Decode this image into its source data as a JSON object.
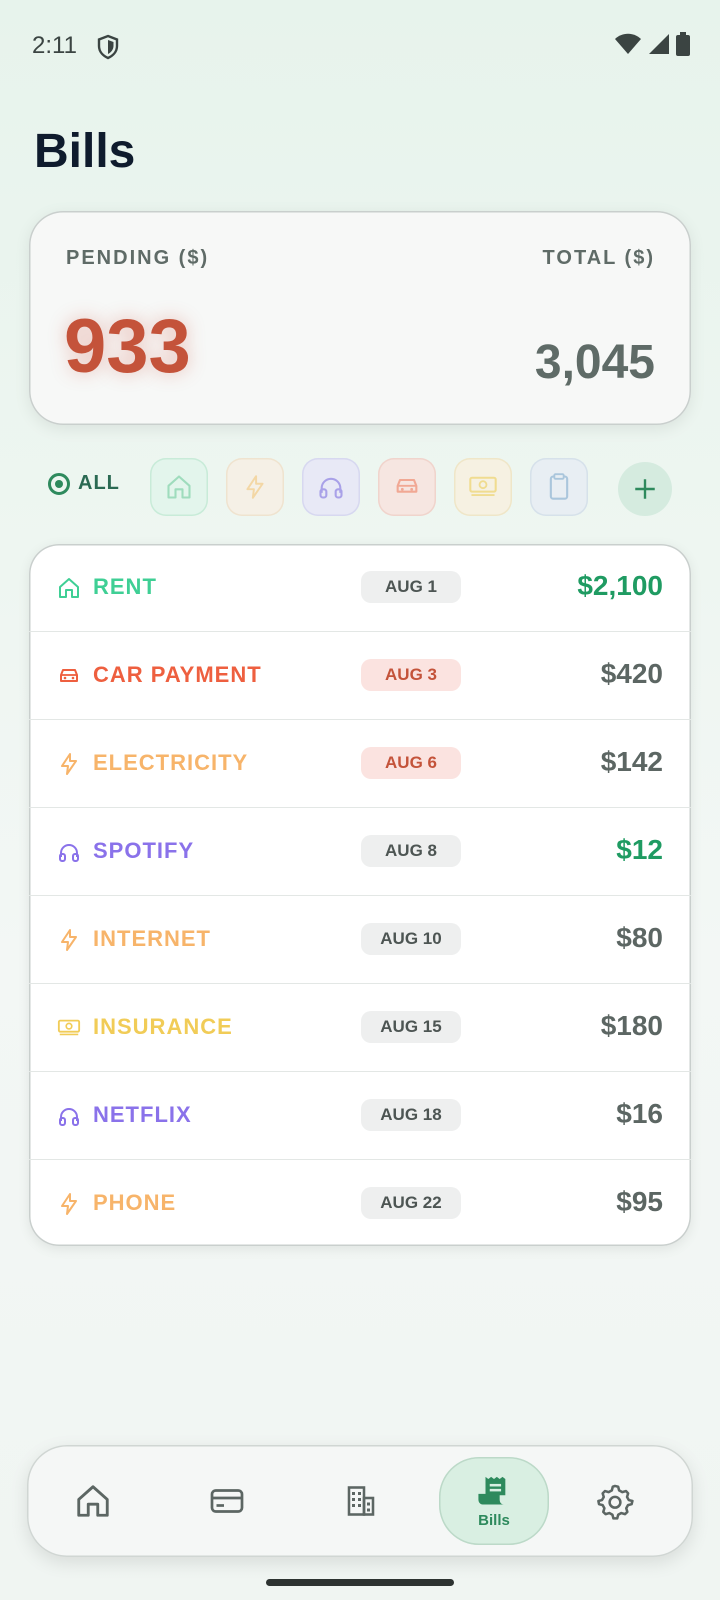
{
  "status": {
    "time": "2:11"
  },
  "page": {
    "title": "Bills"
  },
  "summary": {
    "pending_label": "PENDING ($)",
    "pending_value": "933",
    "total_label": "TOTAL ($)",
    "total_value": "3,045",
    "pending_color": "#c4533a"
  },
  "filters": {
    "all_label": "ALL",
    "chips": [
      "home-icon",
      "bolt-icon",
      "headphones-icon",
      "car-icon",
      "money-icon",
      "clipboard-icon"
    ],
    "add_icon": "plus-icon"
  },
  "bills": [
    {
      "name": "RENT",
      "date": "AUG 1",
      "amount": "$2,100",
      "icon": "home-icon",
      "color": "#3fcf95",
      "amount_color": "#1f9b62",
      "due": false
    },
    {
      "name": "CAR PAYMENT",
      "date": "AUG 3",
      "amount": "$420",
      "icon": "car-icon",
      "color": "#ee5f3f",
      "amount_color": "#5c6663",
      "due": true
    },
    {
      "name": "ELECTRICITY",
      "date": "AUG 6",
      "amount": "$142",
      "icon": "bolt-icon",
      "color": "#f7b46a",
      "amount_color": "#5c6663",
      "due": true
    },
    {
      "name": "SPOTIFY",
      "date": "AUG 8",
      "amount": "$12",
      "icon": "headphones-icon",
      "color": "#8a72ea",
      "amount_color": "#1f9b62",
      "due": false
    },
    {
      "name": "INTERNET",
      "date": "AUG 10",
      "amount": "$80",
      "icon": "bolt-icon",
      "color": "#f7b46a",
      "amount_color": "#5c6663",
      "due": false
    },
    {
      "name": "INSURANCE",
      "date": "AUG 15",
      "amount": "$180",
      "icon": "money-icon",
      "color": "#f1cc57",
      "amount_color": "#5c6663",
      "due": false
    },
    {
      "name": "NETFLIX",
      "date": "AUG 18",
      "amount": "$16",
      "icon": "headphones-icon",
      "color": "#8a72ea",
      "amount_color": "#5c6663",
      "due": false
    },
    {
      "name": "PHONE",
      "date": "AUG 22",
      "amount": "$95",
      "icon": "bolt-icon",
      "color": "#f7b46a",
      "amount_color": "#5c6663",
      "due": false
    }
  ],
  "nav": {
    "items": [
      "home-icon",
      "card-icon",
      "building-icon",
      "bills-icon",
      "gear-icon"
    ],
    "active_label": "Bills"
  }
}
